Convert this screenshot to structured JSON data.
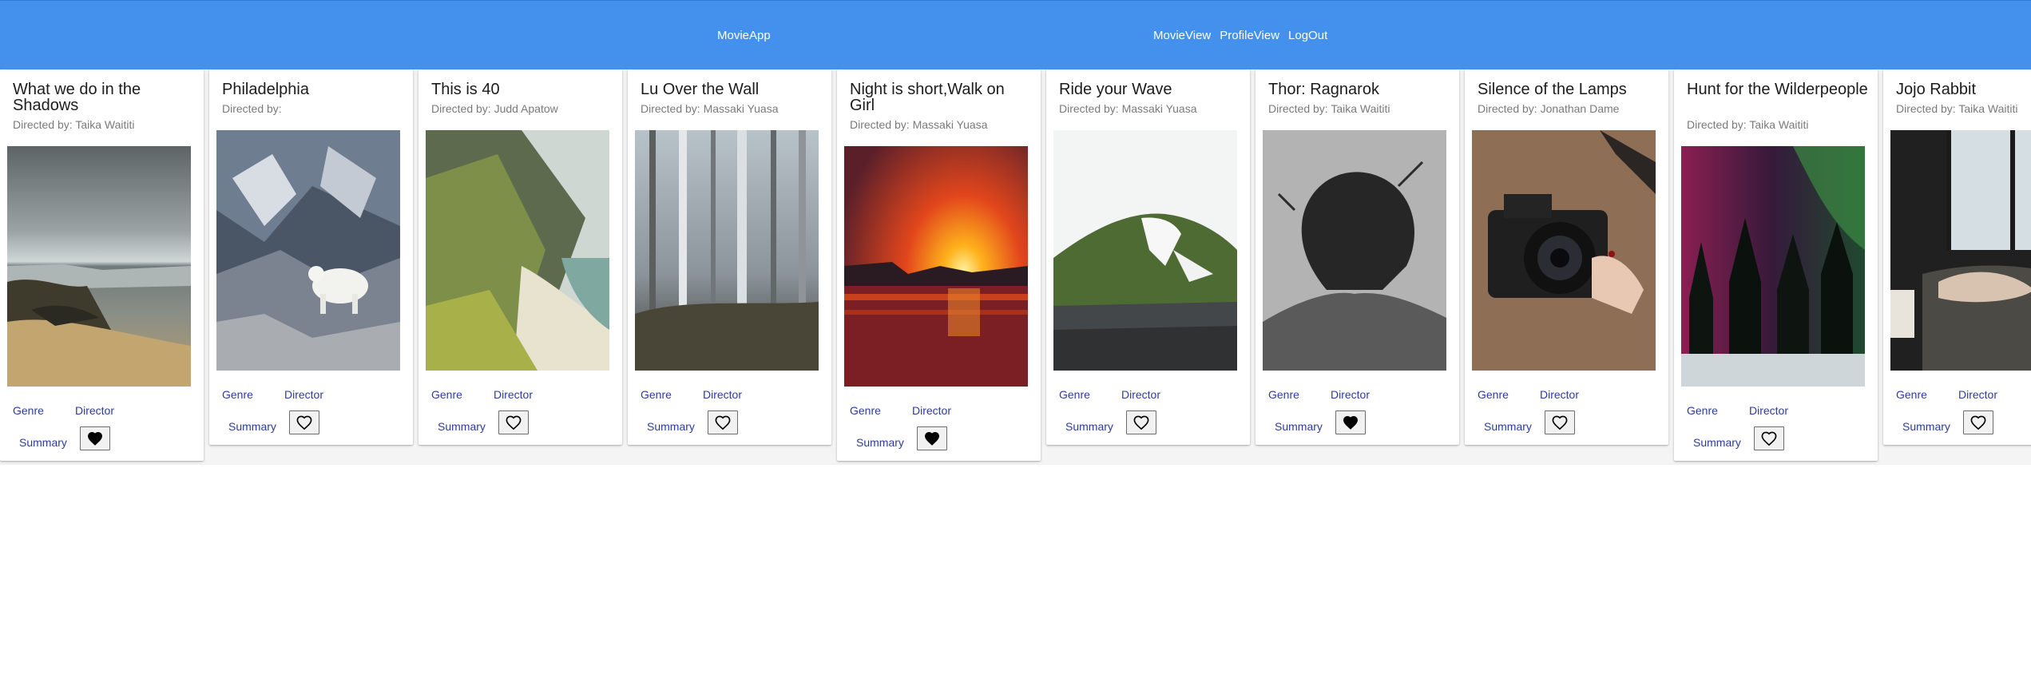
{
  "app": {
    "brand": "MovieApp",
    "nav": [
      "MovieView",
      "ProfileView",
      "LogOut"
    ]
  },
  "labels": {
    "genre": "Genre",
    "director": "Director",
    "summary": "Summary"
  },
  "colors": {
    "toolbar": "#4390ed",
    "link": "#2d3c9c",
    "subtitle": "#7a7a7a"
  },
  "movies": [
    {
      "title": "What we do in the Shadows",
      "director_line": "Directed by: Taika Waititi",
      "favorite": true,
      "image": "rocky-beach-stormy-sky"
    },
    {
      "title": "Philadelphia",
      "director_line": "Directed by:",
      "favorite": false,
      "image": "mountain-goat-on-rocks"
    },
    {
      "title": "This is 40",
      "director_line": "Directed by: Judd Apatow",
      "favorite": false,
      "image": "green-valley-to-sea"
    },
    {
      "title": "Lu Over the Wall",
      "director_line": "Directed by: Massaki Yuasa",
      "favorite": false,
      "image": "misty-forest"
    },
    {
      "title": "Night is short,Walk on Girl",
      "director_line": "Directed by: Massaki Yuasa",
      "favorite": true,
      "image": "sunset-over-sea"
    },
    {
      "title": "Ride your Wave",
      "director_line": "Directed by: Massaki Yuasa",
      "favorite": false,
      "image": "snowy-green-hill"
    },
    {
      "title": "Thor: Ragnarok",
      "director_line": "Directed by: Taika Waititi",
      "favorite": true,
      "image": "woman-back-of-head-grayscale"
    },
    {
      "title": "Silence of the Lamps",
      "director_line": "Directed by: Jonathan Dame",
      "favorite": false,
      "image": "hands-holding-camera"
    },
    {
      "title": "Hunt for the Wilderpeople",
      "director_line": "Directed by: Taika Waititi",
      "favorite": false,
      "image": "aurora-over-pine-trees"
    },
    {
      "title": "Jojo Rabbit",
      "director_line": "Directed by: Taika Waititi",
      "favorite": false,
      "image": "person-by-window"
    }
  ],
  "icons": {
    "favorite_filled": "heart-filled-icon",
    "favorite_empty": "heart-outline-icon",
    "scroll_left": "scroll-left-arrow-icon"
  }
}
